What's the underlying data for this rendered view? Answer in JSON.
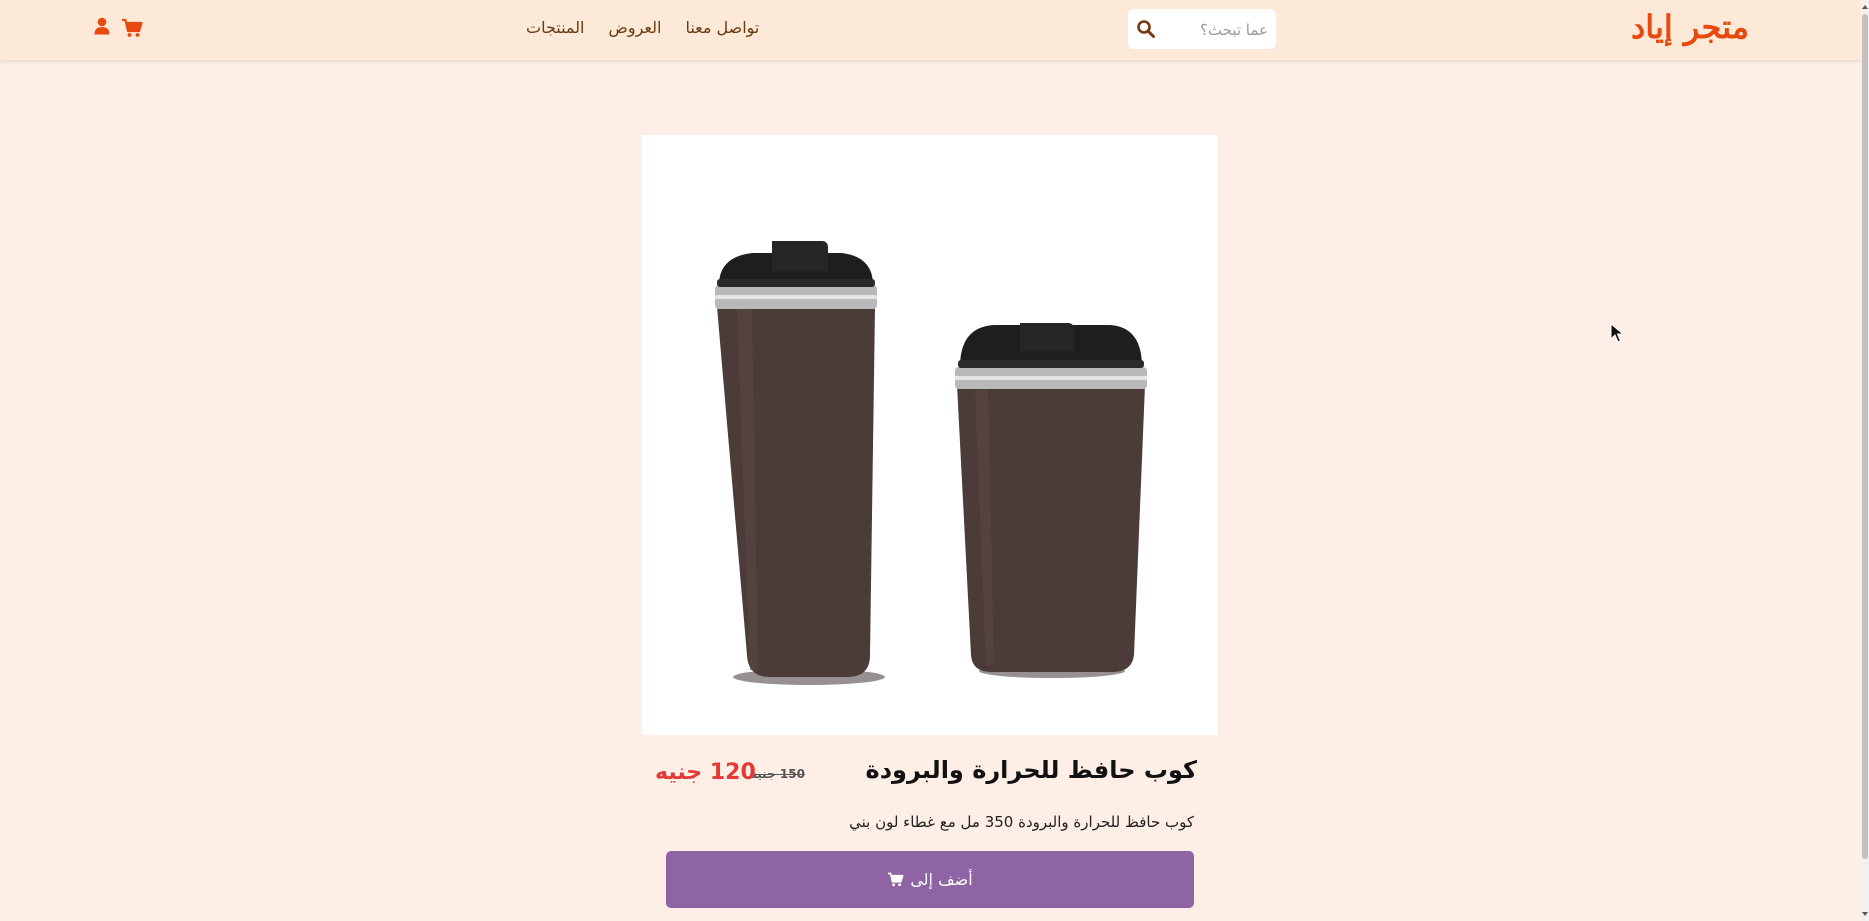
{
  "header": {
    "logo": "متجر إياد",
    "search_placeholder": "عما تبحث؟",
    "nav": {
      "products": "المنتجات",
      "offers": "العروض",
      "contact": "تواصل معنا"
    }
  },
  "product": {
    "name": "كوب حافظ للحرارة والبرودة",
    "price_new": "120 جنيه",
    "price_old": "150 جنيه",
    "description": "كوب حافظ للحرارة والبرودة 350 مل مع غطاء لون بني",
    "add_button": "أضف إلى"
  },
  "colors": {
    "brand": "#e8490f",
    "button": "#8e64a4",
    "sale_price": "#e53935",
    "nav_bg": "#fde9d7",
    "page_bg": "#fdefe6"
  }
}
